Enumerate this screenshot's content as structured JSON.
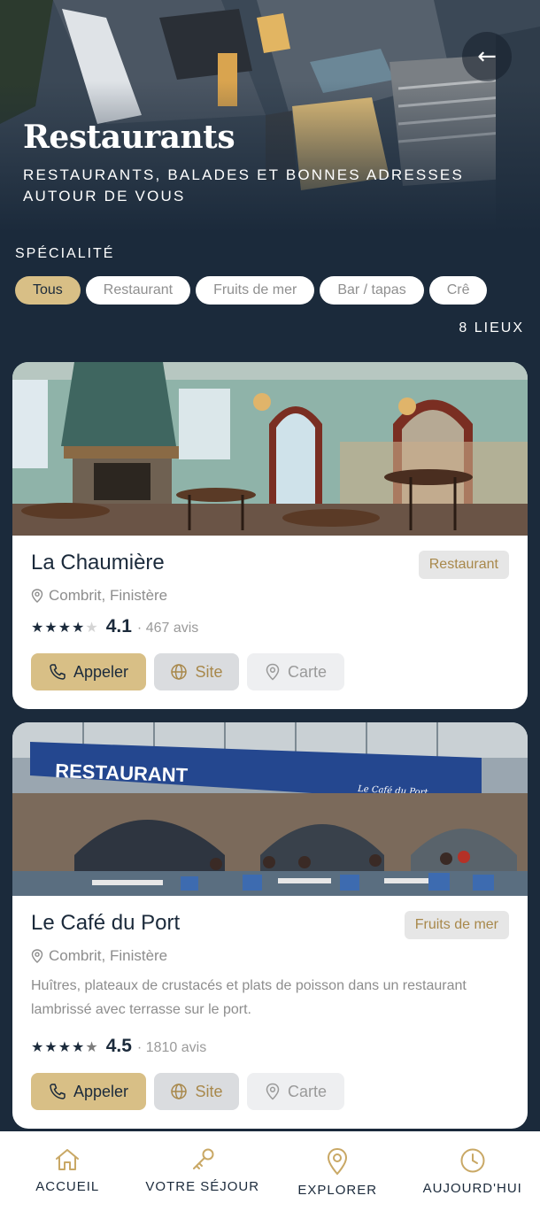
{
  "header": {
    "title": "Restaurants",
    "subtitle": "RESTAURANTS, BALADES ET BONNES ADRESSES AUTOUR DE VOUS",
    "back_icon": "arrow-left-icon"
  },
  "filters": {
    "label": "SPÉCIALITÉ",
    "chips": [
      {
        "label": "Tous",
        "active": true
      },
      {
        "label": "Restaurant",
        "active": false
      },
      {
        "label": "Fruits de mer",
        "active": false
      },
      {
        "label": "Bar / tapas",
        "active": false
      },
      {
        "label": "Crê",
        "active": false
      }
    ]
  },
  "count_label": "8 LIEUX",
  "places": [
    {
      "name": "La Chaumière",
      "category": "Restaurant",
      "location": "Combrit, Finistère",
      "description": "",
      "stars_filled": 4,
      "stars_total": 5,
      "rating": "4.1",
      "reviews": "· 467 avis",
      "call_label": "Appeler",
      "site_label": "Site",
      "map_label": "Carte"
    },
    {
      "name": "Le Café du Port",
      "category": "Fruits de mer",
      "location": "Combrit, Finistère",
      "description": "Huîtres, plateaux de crustacés et plats de poisson dans un restaurant lambrissé avec terrasse sur le port.",
      "stars_filled": 4.5,
      "stars_total": 5,
      "rating": "4.5",
      "reviews": "· 1810 avis",
      "call_label": "Appeler",
      "site_label": "Site",
      "map_label": "Carte",
      "photo_sign": "RESTAURANT",
      "photo_sign_small": "Le Café du Port"
    }
  ],
  "bottom_nav": [
    {
      "label": "ACCUEIL",
      "icon": "home-icon"
    },
    {
      "label": "VOTRE SÉJOUR",
      "icon": "key-icon"
    },
    {
      "label": "EXPLORER",
      "icon": "map-pin-icon"
    },
    {
      "label": "AUJOURD'HUI",
      "icon": "clock-icon"
    }
  ],
  "colors": {
    "background": "#1b2a3b",
    "accent": "#d8bf86",
    "tag_text": "#a8884b"
  }
}
